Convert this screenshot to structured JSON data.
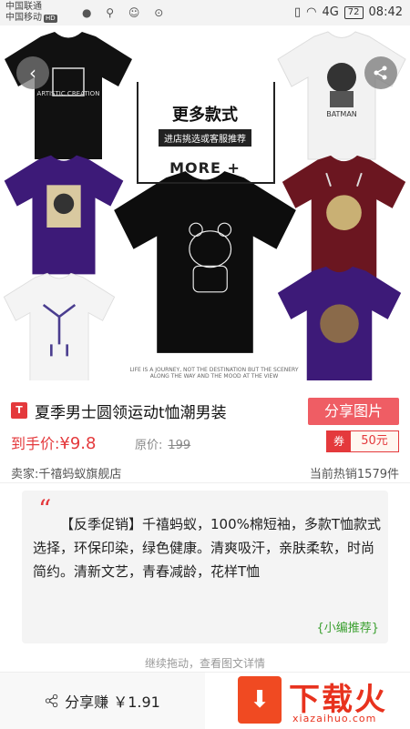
{
  "status_bar": {
    "carrier1": "中国联通",
    "carrier2": "中国移动",
    "hd": "HD",
    "signal": "4G",
    "battery": "72",
    "time": "08:42"
  },
  "hero": {
    "promo_title": "更多款式",
    "promo_sub": "进店挑选或客服推荐",
    "promo_more": "MORE +",
    "caption_line1": "LIFE IS A JOURNEY, NOT THE DESTINATION BUT THE SCENERY",
    "caption_line2": "ALONG THE WAY AND THE MOOD AT THE VIEW",
    "shirt_prints": [
      "ARTISTIC CREATION",
      "BATMAN"
    ],
    "carousel": {
      "count": 4,
      "active": 0
    }
  },
  "product": {
    "platform_icon": "T",
    "title": "夏季男士圆领运动t恤潮男装",
    "share_image_label": "分享图片",
    "price_label": "到手价:",
    "price": "¥9.8",
    "original_label": "原价:",
    "original_price": "199",
    "coupon_tag": "券",
    "coupon_value": "50元",
    "seller": "卖家:千禧蚂蚁旗舰店",
    "sold": "当前热销1579件"
  },
  "recommendation": {
    "text": "【反季促销】千禧蚂蚁，100%棉短袖，多款T恤款式选择，环保印染，绿色健康。清爽吸汗，亲肤柔软，时尚简约。清新文艺，青春减龄，花样T恤",
    "tag": "{小编推荐}"
  },
  "continue_text": "继续拖动，查看图文详情",
  "bottom_bar": {
    "earn_label": "分享赚 ￥1.91",
    "logo_text": "下载火",
    "logo_sub": "xiazaihuo.com"
  },
  "colors": {
    "accent_red": "#e4393c",
    "share_btn": "#ef5d64",
    "active_dot": "#f07a20",
    "tag_green": "#3a9f2f"
  }
}
